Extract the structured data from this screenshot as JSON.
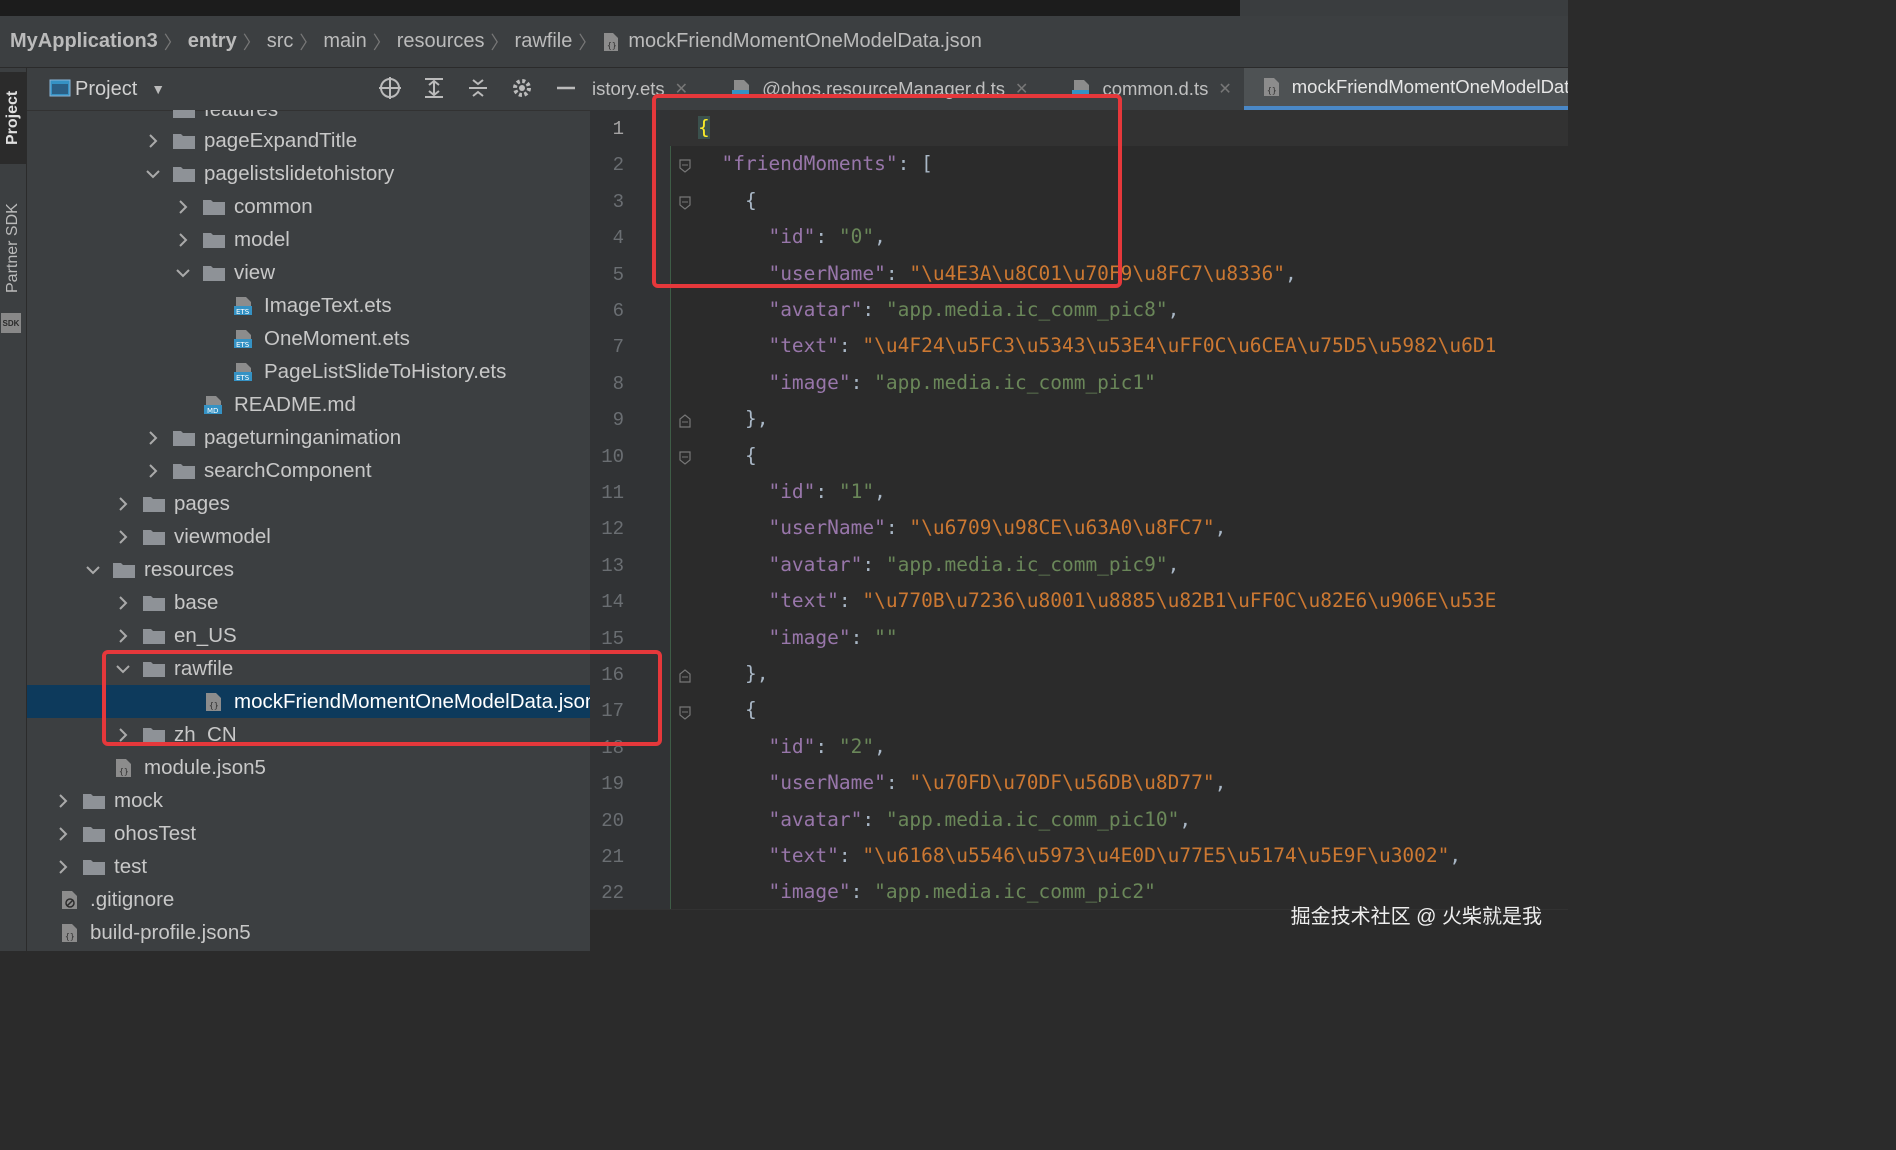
{
  "breadcrumb": {
    "items": [
      "MyApplication3",
      "entry",
      "src",
      "main",
      "resources",
      "rawfile",
      "mockFriendMomentOneModelData.json"
    ]
  },
  "sidebar_tabs": {
    "project": "Project",
    "partner_sdk": "Partner SDK",
    "sdk_badge": "SDK"
  },
  "project_panel": {
    "title": "Project",
    "tree": [
      {
        "label": "features",
        "type": "folder"
      },
      {
        "label": "pageExpandTitle",
        "type": "folder"
      },
      {
        "label": "pagelistslidetohistory",
        "type": "folder"
      },
      {
        "label": "common",
        "type": "folder"
      },
      {
        "label": "model",
        "type": "folder"
      },
      {
        "label": "view",
        "type": "folder"
      },
      {
        "label": "ImageText.ets",
        "type": "ets"
      },
      {
        "label": "OneMoment.ets",
        "type": "ets"
      },
      {
        "label": "PageListSlideToHistory.ets",
        "type": "ets"
      },
      {
        "label": "README.md",
        "type": "md"
      },
      {
        "label": "pageturninganimation",
        "type": "folder"
      },
      {
        "label": "searchComponent",
        "type": "folder"
      },
      {
        "label": "pages",
        "type": "folder"
      },
      {
        "label": "viewmodel",
        "type": "folder"
      },
      {
        "label": "resources",
        "type": "folder"
      },
      {
        "label": "base",
        "type": "folder"
      },
      {
        "label": "en_US",
        "type": "folder"
      },
      {
        "label": "rawfile",
        "type": "folder"
      },
      {
        "label": "mockFriendMomentOneModelData.json",
        "type": "json"
      },
      {
        "label": "zh_CN",
        "type": "folder"
      },
      {
        "label": "module.json5",
        "type": "json"
      },
      {
        "label": "mock",
        "type": "folder"
      },
      {
        "label": "ohosTest",
        "type": "folder"
      },
      {
        "label": "test",
        "type": "folder"
      },
      {
        "label": ".gitignore",
        "type": "ignore"
      },
      {
        "label": "build-profile.json5",
        "type": "json"
      }
    ]
  },
  "editor": {
    "tabs": [
      {
        "label": "istory.ets",
        "active": false
      },
      {
        "label": "@ohos.resourceManager.d.ts",
        "active": false
      },
      {
        "label": "common.d.ts",
        "active": false
      },
      {
        "label": "mockFriendMomentOneModelData.",
        "active": true
      }
    ],
    "line_numbers": [
      "1",
      "2",
      "3",
      "4",
      "5",
      "6",
      "7",
      "8",
      "9",
      "10",
      "11",
      "12",
      "13",
      "14",
      "15",
      "16",
      "17",
      "18",
      "19",
      "20",
      "21",
      "22"
    ],
    "lines": {
      "l1": "{",
      "l2_key": "\"friendMoments\"",
      "l2_rest": ": [",
      "l3": "{",
      "l4_key": "\"id\"",
      "l4_val": "\"0\"",
      "l5_key": "\"userName\"",
      "l5_val": "\"\\u4E3A\\u8C01\\u70F9\\u8FC7\\u8336\"",
      "l6_key": "\"avatar\"",
      "l6_val": "\"app.media.ic_comm_pic8\"",
      "l7_key": "\"text\"",
      "l7_val": "\"\\u4F24\\u5FC3\\u5343\\u53E4\\uFF0C\\u6CEA\\u75D5\\u5982\\u6D1",
      "l8_key": "\"image\"",
      "l8_val": "\"app.media.ic_comm_pic1\"",
      "l9": "},",
      "l10": "{",
      "l11_key": "\"id\"",
      "l11_val": "\"1\"",
      "l12_key": "\"userName\"",
      "l12_val": "\"\\u6709\\u98CE\\u63A0\\u8FC7\"",
      "l13_key": "\"avatar\"",
      "l13_val": "\"app.media.ic_comm_pic9\"",
      "l14_key": "\"text\"",
      "l14_val": "\"\\u770B\\u7236\\u8001\\u8885\\u82B1\\uFF0C\\u82E6\\u906E\\u53E",
      "l15_key": "\"image\"",
      "l15_val": "\"\"",
      "l16": "},",
      "l17": "{",
      "l18_key": "\"id\"",
      "l18_val": "\"2\"",
      "l19_key": "\"userName\"",
      "l19_val": "\"\\u70FD\\u70DF\\u56DB\\u8D77\"",
      "l20_key": "\"avatar\"",
      "l20_val": "\"app.media.ic_comm_pic10\"",
      "l21_key": "\"text\"",
      "l21_val": "\"\\u6168\\u5546\\u5973\\u4E0D\\u77E5\\u5174\\u5E9F\\u3002\"",
      "l22_key": "\"image\"",
      "l22_val": "\"app.media.ic_comm_pic2\""
    }
  },
  "watermark": "掘金技术社区 @ 火柴就是我",
  "colors": {
    "highlight_box": "#e5383b",
    "selection": "#0d3a5c",
    "key": "#9876aa",
    "string": "#6a8759",
    "escape": "#cc7832"
  }
}
